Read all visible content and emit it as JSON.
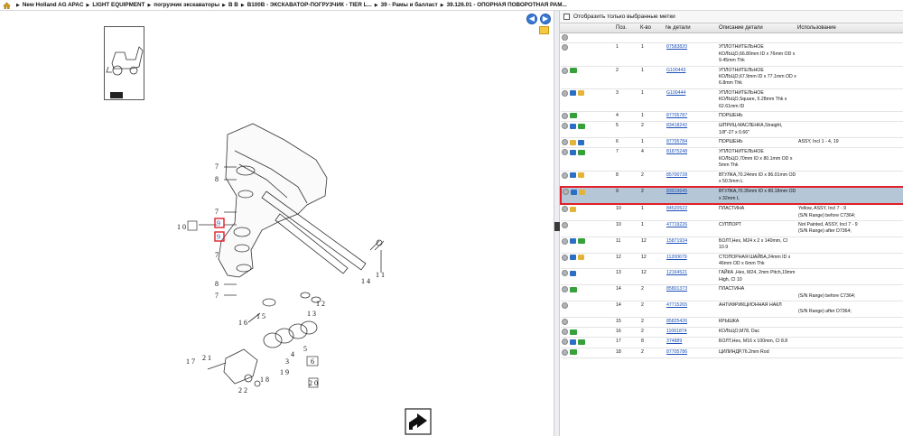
{
  "breadcrumbs": [
    "New Holland AG APAC",
    "LIGHT EQUIPMENT",
    "погрузчик экскаваторы",
    "В В",
    "B100B - ЭКСКАВАТОР-ПОГРУЗЧИК - TIER L...",
    "39 - Рамы и балласт",
    "39.126.01 - ОПОРНАЯ ПОВОРОТНАЯ РАМ..."
  ],
  "nav": {
    "prev": "◀",
    "next": "▶"
  },
  "filter_label": "Отобразить только выбранные метки",
  "columns": {
    "pos": "Поз.",
    "qty": "К-во",
    "part": "№ детали",
    "desc": "Описание детали",
    "usage": "Использование"
  },
  "diagram_labels": {
    "l7a": "7",
    "l8a": "8",
    "l7b": "7",
    "l7c": "7",
    "l8b": "8",
    "l7d": "7",
    "l9a": "9",
    "l9b": "9",
    "l10": "1 0",
    "l16": "1 6",
    "l14": "1 4",
    "l11": "1 1",
    "l12": "1 2",
    "l13": "1 3",
    "l15": "1 5",
    "l17": "1 7",
    "l4": "4",
    "l3": "3",
    "l5": "5",
    "l6": "6",
    "l18": "1 8",
    "l21": "2 1",
    "l22": "2 2",
    "l20": "2 0",
    "l19": "1 9"
  },
  "rows": [
    {
      "icons": [
        "dot"
      ],
      "pos": "",
      "qty": "",
      "part": "",
      "desc": "",
      "usage": []
    },
    {
      "icons": [
        "dot"
      ],
      "pos": "1",
      "qty": "1",
      "part": "87583820",
      "desc": "УПЛОТНИТЕЛЬНОЕ КОЛЬЦО,66.80mm ID x 76mm OD x 9.45mm Thk",
      "usage": []
    },
    {
      "icons": [
        "dot",
        "gr"
      ],
      "pos": "2",
      "qty": "1",
      "part": "G100443",
      "desc": "УПЛОТНИТЕЛЬНОЕ КОЛЬЦО,67.9mm ID x 77.1mm OD x 6.8mm Thk",
      "usage": []
    },
    {
      "icons": [
        "dot",
        "bl",
        "bx"
      ],
      "pos": "3",
      "qty": "1",
      "part": "G100444",
      "desc": "УПЛОТНИТЕЛЬНОЕ КОЛЬЦО,Square, 5.28mm Thk x 62.61mm ID",
      "usage": []
    },
    {
      "icons": [
        "dot",
        "gr"
      ],
      "pos": "4",
      "qty": "1",
      "part": "87705787",
      "desc": "ПОРШЕНЬ",
      "usage": []
    },
    {
      "icons": [
        "dot",
        "bl",
        "gr"
      ],
      "pos": "5",
      "qty": "2",
      "part": "83418242",
      "desc": "ШПРИЦ-МАСЛЕНКА,Straight, 1/8\"-27 x 0.66\"",
      "usage": []
    },
    {
      "icons": [
        "dot",
        "bx",
        "bl"
      ],
      "pos": "6",
      "qty": "1",
      "part": "87705784",
      "desc": "ПОРШЕНЬ",
      "usage": [
        "ASSY, Incl 1 - 4, 19"
      ]
    },
    {
      "icons": [
        "dot",
        "bl",
        "gr"
      ],
      "pos": "7",
      "qty": "4",
      "part": "81875248",
      "desc": "УПЛОТНИТЕЛЬНОЕ КОЛЬЦО,70mm ID x 80.1mm OD x 5mm Thk",
      "usage": []
    },
    {
      "icons": [
        "dot",
        "bl",
        "bx"
      ],
      "pos": "8",
      "qty": "2",
      "part": "85700728",
      "desc": "ВТУЛКА,70.24mm ID x 86.01mm OD x 50.5mm L",
      "usage": []
    },
    {
      "icons": [
        "dot",
        "bl",
        "bx"
      ],
      "pos": "9",
      "qty": "2",
      "part": "83919645",
      "desc": "ВТУЛКА,70.35mm ID x 80.18mm OD x 32mm L",
      "usage": [],
      "selected": true
    },
    {
      "icons": [
        "dot",
        "bx"
      ],
      "pos": "10",
      "qty": "1",
      "part": "84520522",
      "desc": "ПЛАСТИНА",
      "usage": [
        "Yellow, ASSY, Incl 7 - 9",
        "(S/N Range) before C7364;"
      ]
    },
    {
      "icons": [
        "dot"
      ],
      "pos": "10",
      "qty": "1",
      "part": "47719226",
      "desc": "СУППОРТ",
      "usage": [
        "Not Painted, ASSY, Incl 7 - 9",
        "(S/N Range) after D7364;"
      ]
    },
    {
      "icons": [
        "dot",
        "bl",
        "gr"
      ],
      "pos": "11",
      "qty": "12",
      "part": "15871934",
      "desc": "БОЛТ,Hex, M24 x 2 x 140mm, Cl 10.9",
      "usage": []
    },
    {
      "icons": [
        "dot",
        "bl",
        "bx"
      ],
      "pos": "12",
      "qty": "12",
      "part": "11200679",
      "desc": "СТОПОРНАЯ ШАЙБА,24mm ID x 46mm OD x 6mm Thk",
      "usage": []
    },
    {
      "icons": [
        "dot",
        "bl"
      ],
      "pos": "13",
      "qty": "12",
      "part": "12164521",
      "desc": "ГАЙКА ,Hex, M24, 2mm Pitch,19mm High, Cl 10",
      "usage": []
    },
    {
      "icons": [
        "dot",
        "gr"
      ],
      "pos": "14",
      "qty": "2",
      "part": "85801373",
      "desc": "ПЛАСТИНА",
      "usage": [
        "",
        "(S/N Range) before C7364;"
      ]
    },
    {
      "icons": [
        "dot"
      ],
      "pos": "14",
      "qty": "2",
      "part": "47715265",
      "desc": "АНТИФРИКЦИОННАЯ НАКЛ",
      "usage": [
        "",
        "(S/N Range) after D7364;"
      ]
    },
    {
      "icons": [
        "dot"
      ],
      "pos": "15",
      "qty": "2",
      "part": "85825426",
      "desc": "КРЫШКА",
      "usage": []
    },
    {
      "icons": [
        "dot",
        "gr"
      ],
      "pos": "16",
      "qty": "2",
      "part": "11061874",
      "desc": "КОЛЬЦО,M78, Dac",
      "usage": []
    },
    {
      "icons": [
        "dot",
        "bl",
        "gr"
      ],
      "pos": "17",
      "qty": "8",
      "part": "374889",
      "desc": "БОЛТ,Hex, M16 x 100mm, Cl 8.8",
      "usage": []
    },
    {
      "icons": [
        "dot",
        "gr"
      ],
      "pos": "18",
      "qty": "2",
      "part": "87705786",
      "desc": "ЦИЛИНДР,76.2mm Rod",
      "usage": []
    }
  ]
}
